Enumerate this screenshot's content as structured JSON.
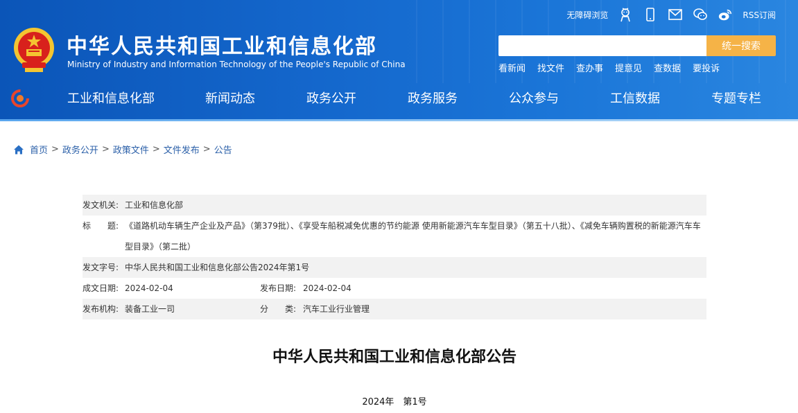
{
  "header": {
    "site_title": "中华人民共和国工业和信息化部",
    "site_title_en": "Ministry of Industry and Information Technology of the People's Republic of China",
    "toolbar": {
      "accessibility": "无障碍浏览",
      "rss": "RSS订阅"
    },
    "search": {
      "value": "",
      "placeholder": "",
      "button_label": "统一搜索"
    },
    "quick_links": [
      "看新闻",
      "找文件",
      "查办事",
      "提意见",
      "查数据",
      "要投诉"
    ],
    "colors": {
      "primary": "#1467cc",
      "accent": "#f5b347"
    }
  },
  "nav": {
    "items": [
      "工业和信息化部",
      "新闻动态",
      "政务公开",
      "政务服务",
      "公众参与",
      "工信数据",
      "专题专栏"
    ]
  },
  "breadcrumb": [
    "首页",
    "政务公开",
    "政策文件",
    "文件发布",
    "公告"
  ],
  "meta": {
    "issuer_label": "发文机关:",
    "issuer_value": "工业和信息化部",
    "title_label": "标　　题:",
    "title_value": "《道路机动车辆生产企业及产品》（第379批）、《享受车船税减免优惠的节约能源 使用新能源汽车车型目录》（第五十八批）、《减免车辆购置税的新能源汽车车型目录》（第二批）",
    "doc_no_label": "发文字号:",
    "doc_no_value": "中华人民共和国工业和信息化部公告2024年第1号",
    "created_label": "成文日期:",
    "created_value": "2024-02-04",
    "published_label": "发布日期:",
    "published_value": "2024-02-04",
    "org_label": "发布机构:",
    "org_value": "装备工业一司",
    "category_label": "分　　类:",
    "category_value": "汽车工业行业管理"
  },
  "document": {
    "title": "中华人民共和国工业和信息化部公告",
    "number": "2024年　第1号"
  }
}
